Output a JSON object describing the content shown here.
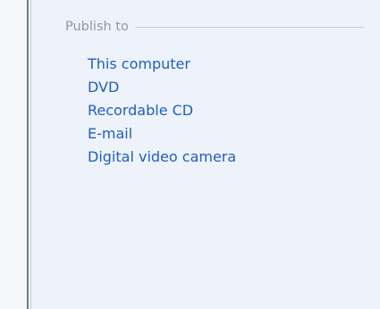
{
  "publish_section": {
    "title": "Publish to",
    "items": [
      {
        "label": "This computer"
      },
      {
        "label": "DVD"
      },
      {
        "label": "Recordable CD"
      },
      {
        "label": "E-mail"
      },
      {
        "label": "Digital video camera"
      }
    ]
  }
}
